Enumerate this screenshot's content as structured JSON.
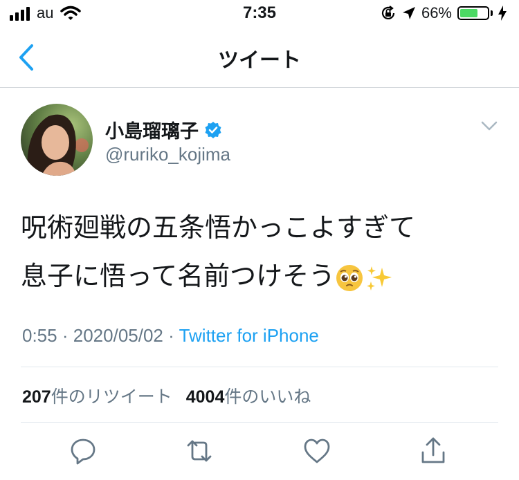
{
  "status_bar": {
    "carrier": "au",
    "time": "7:35",
    "battery_percent": "66%",
    "battery_level": 0.66,
    "battery_color": "#4cd964"
  },
  "nav": {
    "title": "ツイート",
    "back_icon": "chevron-left-icon",
    "accent_color": "#1da1f2"
  },
  "tweet": {
    "display_name": "小島瑠璃子",
    "verified": true,
    "handle": "@ruriko_kojima",
    "text_line1": "呪術廻戦の五条悟かっこよすぎて",
    "text_line2": "息子に悟って名前つけそう",
    "emojis": [
      "pleading-face-emoji",
      "sparkles-emoji"
    ],
    "time": "0:55",
    "date": "2020/05/02",
    "separator": "·",
    "source": "Twitter for iPhone"
  },
  "stats": {
    "retweets_count": "207",
    "retweets_label": "件のリツイート",
    "likes_count": "4004",
    "likes_label": "件のいいね"
  },
  "actions": [
    "reply-icon",
    "retweet-icon",
    "like-icon",
    "share-icon"
  ]
}
